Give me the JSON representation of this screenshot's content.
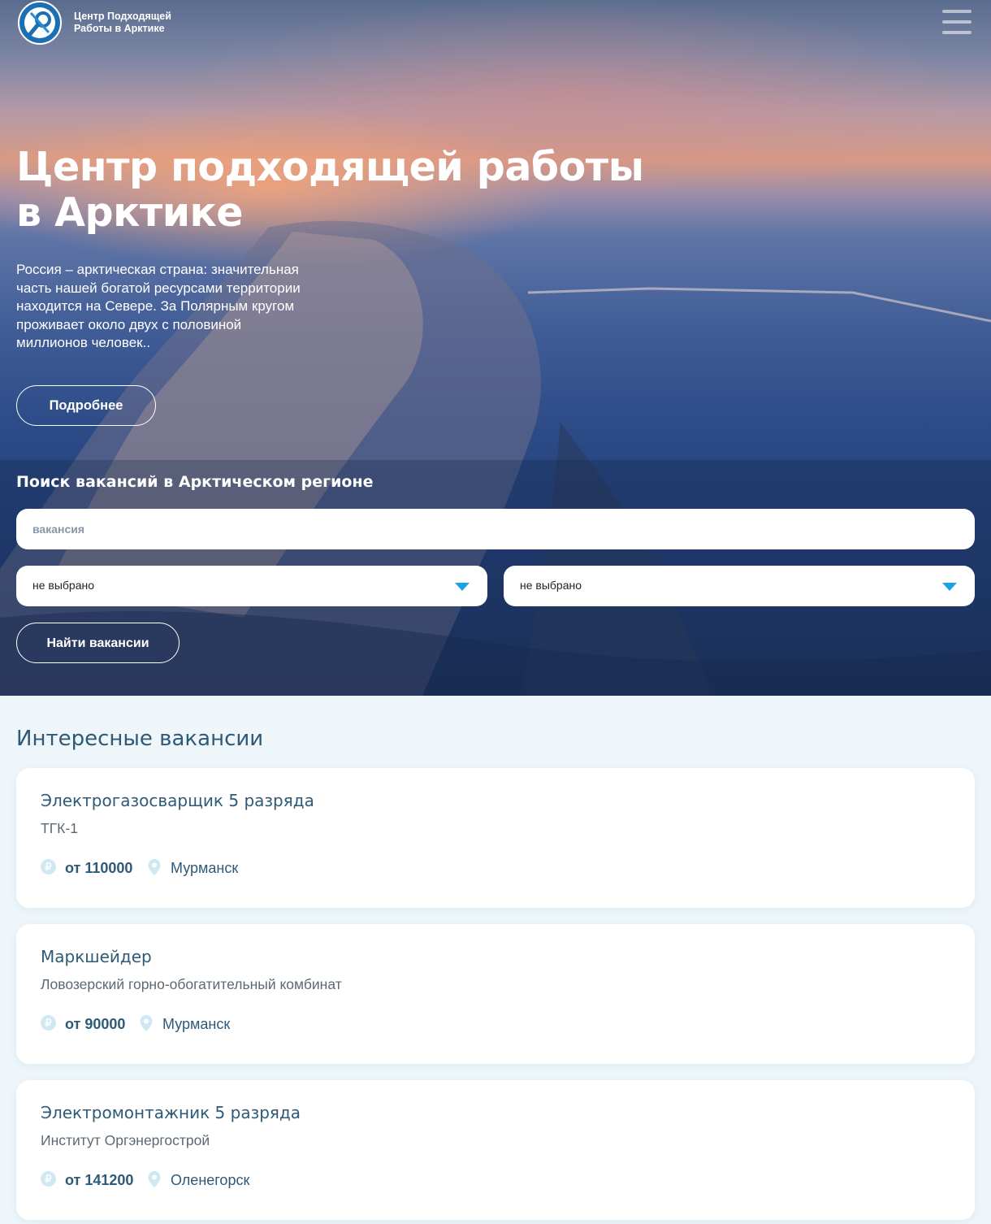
{
  "header": {
    "logo_text_line1": "Центр Подходящей",
    "logo_text_line2": "Работы в Арктике",
    "logo_icon": "magnifier-and-wrench-emblem",
    "menu_icon": "hamburger-menu-icon"
  },
  "hero": {
    "title": "Центр подходящей работы в Арктике",
    "text": "Россия – арктическая страна: значительная часть нашей богатой ресурсами территории находится на Севере. За Полярным кругом проживает около двух с половиной миллионов человек..",
    "more_button": "Подробнее"
  },
  "search": {
    "title": "Поиск вакансий в Арктическом регионе",
    "placeholder": "вакансия",
    "select1_value": "не выбрано",
    "select2_value": "не выбрано",
    "find_button": "Найти вакансии"
  },
  "vacancies": {
    "title": "Интересные вакансии",
    "items": [
      {
        "job": "Электрогазосварщик 5 разряда",
        "company": "ТГК-1",
        "salary": "от 110000",
        "city": "Мурманск"
      },
      {
        "job": "Маркшейдер",
        "company": "Ловозерский горно-обогатительный комбинат",
        "salary": "от 90000",
        "city": "Мурманск"
      },
      {
        "job": "Электромонтажник 5 разряда",
        "company": "Институт Оргэнергострой",
        "salary": "от 141200",
        "city": "Оленегорск"
      }
    ]
  },
  "colors": {
    "accent": "#1da1e6",
    "heading": "#2e5a78",
    "section_bg": "#eef6fa"
  }
}
